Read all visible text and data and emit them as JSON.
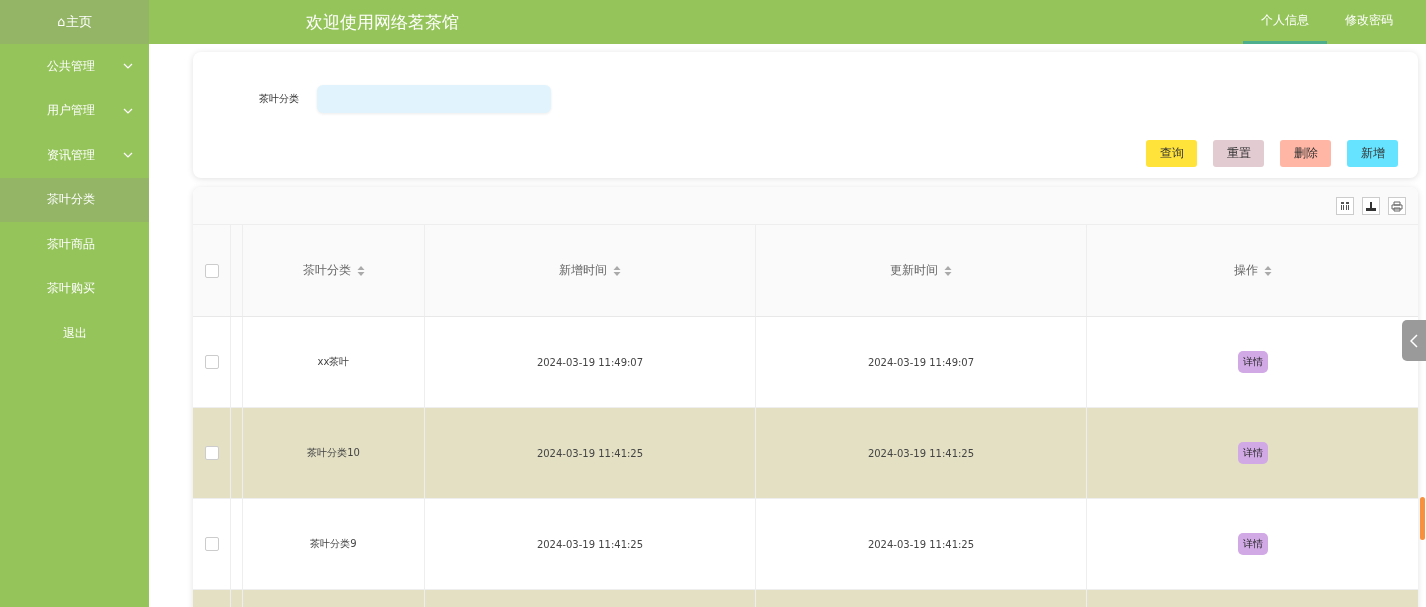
{
  "sidebar": {
    "home": "⌂主页",
    "items": [
      {
        "label": "公共管理",
        "expandable": true,
        "selected": false
      },
      {
        "label": "用户管理",
        "expandable": true,
        "selected": false
      },
      {
        "label": "资讯管理",
        "expandable": true,
        "selected": false
      },
      {
        "label": "茶叶分类",
        "expandable": false,
        "selected": true
      },
      {
        "label": "茶叶商品",
        "expandable": false,
        "selected": false
      },
      {
        "label": "茶叶购买",
        "expandable": false,
        "selected": false
      },
      {
        "label": "退出",
        "expandable": false,
        "selected": false
      }
    ]
  },
  "header": {
    "title": "欢迎使用网络茗茶馆",
    "tabs": [
      {
        "label": "个人信息",
        "selected": true
      },
      {
        "label": "修改密码",
        "selected": false
      }
    ]
  },
  "search": {
    "label": "茶叶分类",
    "buttons": [
      {
        "label": "查询",
        "color": "#ffe33b"
      },
      {
        "label": "重置",
        "color": "#e3cbd2"
      },
      {
        "label": "删除",
        "color": "#ffb6a5"
      },
      {
        "label": "新增",
        "color": "#66e4ff"
      }
    ]
  },
  "table": {
    "select_all_checked": false,
    "columns": [
      "茶叶分类",
      "新增时间",
      "更新时间",
      "操作"
    ],
    "rows": [
      {
        "checked": false,
        "cells": [
          "xx茶叶",
          "2024-03-19 11:49:07",
          "2024-03-19 11:49:07"
        ],
        "action": "详情"
      },
      {
        "checked": false,
        "cells": [
          "茶叶分类10",
          "2024-03-19 11:41:25",
          "2024-03-19 11:41:25"
        ],
        "action": "详情"
      },
      {
        "checked": false,
        "cells": [
          "茶叶分类9",
          "2024-03-19 11:41:25",
          "2024-03-19 11:41:25"
        ],
        "action": "详情"
      }
    ]
  }
}
